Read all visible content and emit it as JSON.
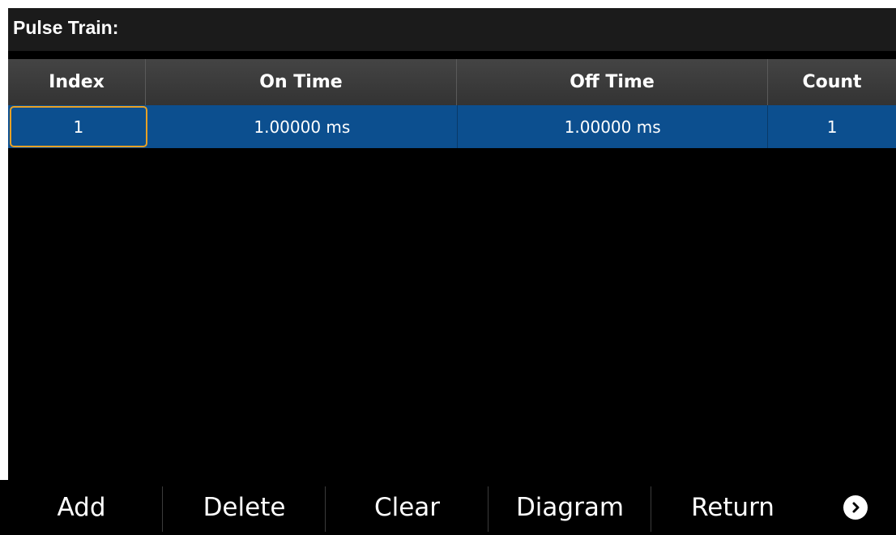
{
  "title": "Pulse Train:",
  "table": {
    "headers": [
      "Index",
      "On Time",
      "Off Time",
      "Count"
    ],
    "rows": [
      [
        "1",
        "1.00000 ms",
        "1.00000 ms",
        "1"
      ]
    ]
  },
  "softkeys": [
    "Add",
    "Delete",
    "Clear",
    "Diagram",
    "Return"
  ],
  "more_icon": "chevron-right-circle-icon",
  "colors": {
    "selected_row": "#0c4f8f",
    "selected_cell_border": "#e8a126",
    "header_bg": "#3a3a3a",
    "title_bg": "#1b1b1b"
  }
}
